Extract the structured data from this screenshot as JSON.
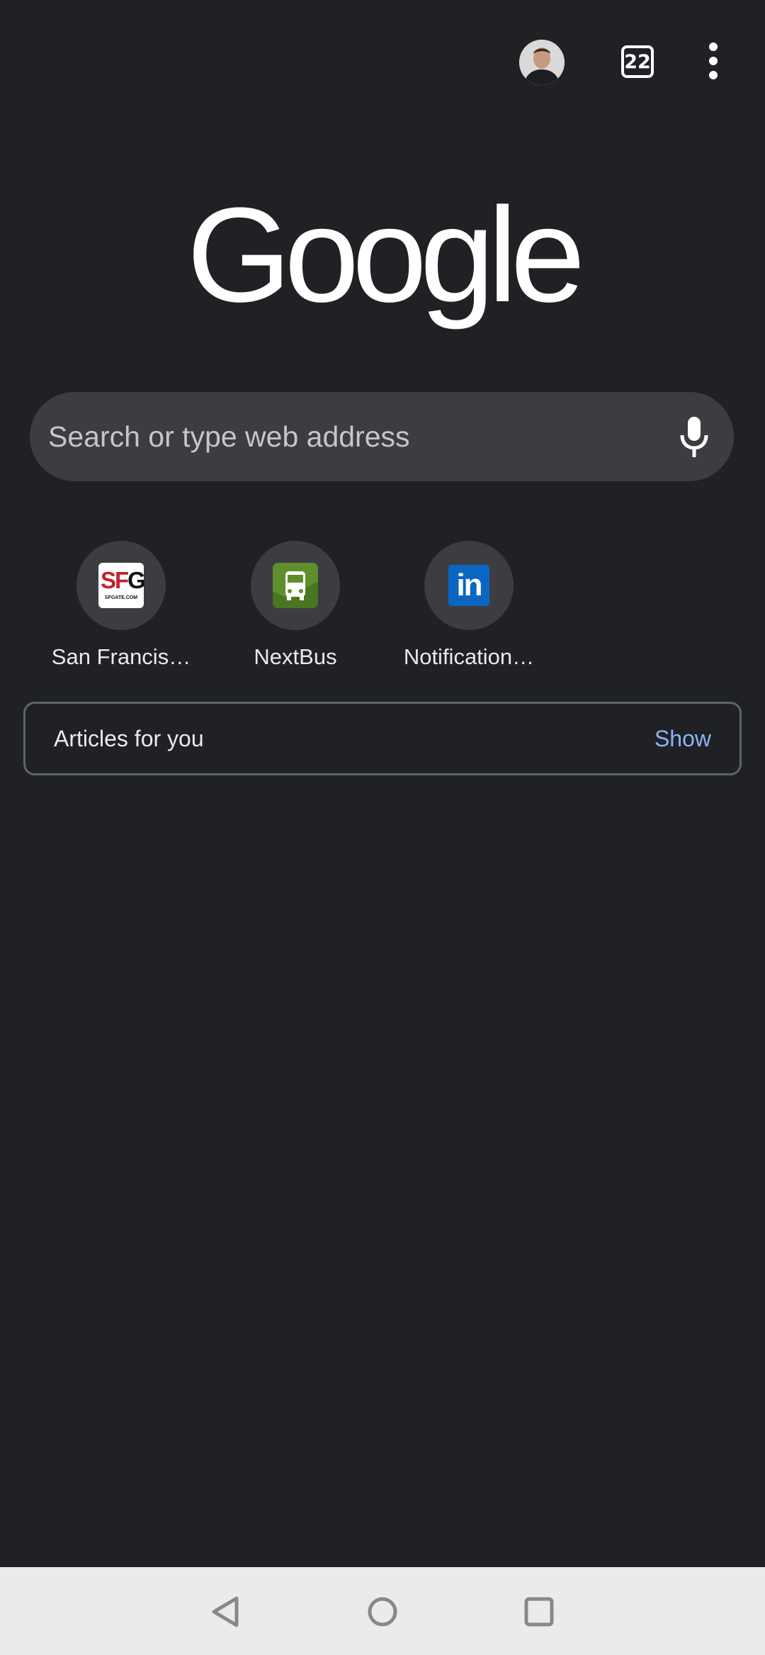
{
  "toolbar": {
    "tab_count": "22"
  },
  "logo": {
    "text": "Google"
  },
  "search": {
    "placeholder": "Search or type web address"
  },
  "shortcuts": [
    {
      "label": "San Francis…",
      "icon": "sfgate-icon",
      "icon_text": "SFG",
      "icon_subtext": "SFGATE.COM"
    },
    {
      "label": "NextBus",
      "icon": "nextbus-icon"
    },
    {
      "label": "Notification…",
      "icon": "linkedin-icon",
      "icon_text": "in"
    }
  ],
  "feed": {
    "title": "Articles for you",
    "action": "Show"
  },
  "colors": {
    "background": "#202124",
    "search_bg": "#3c3d40",
    "link": "#8ab4f8",
    "navbar": "#ebebeb"
  }
}
